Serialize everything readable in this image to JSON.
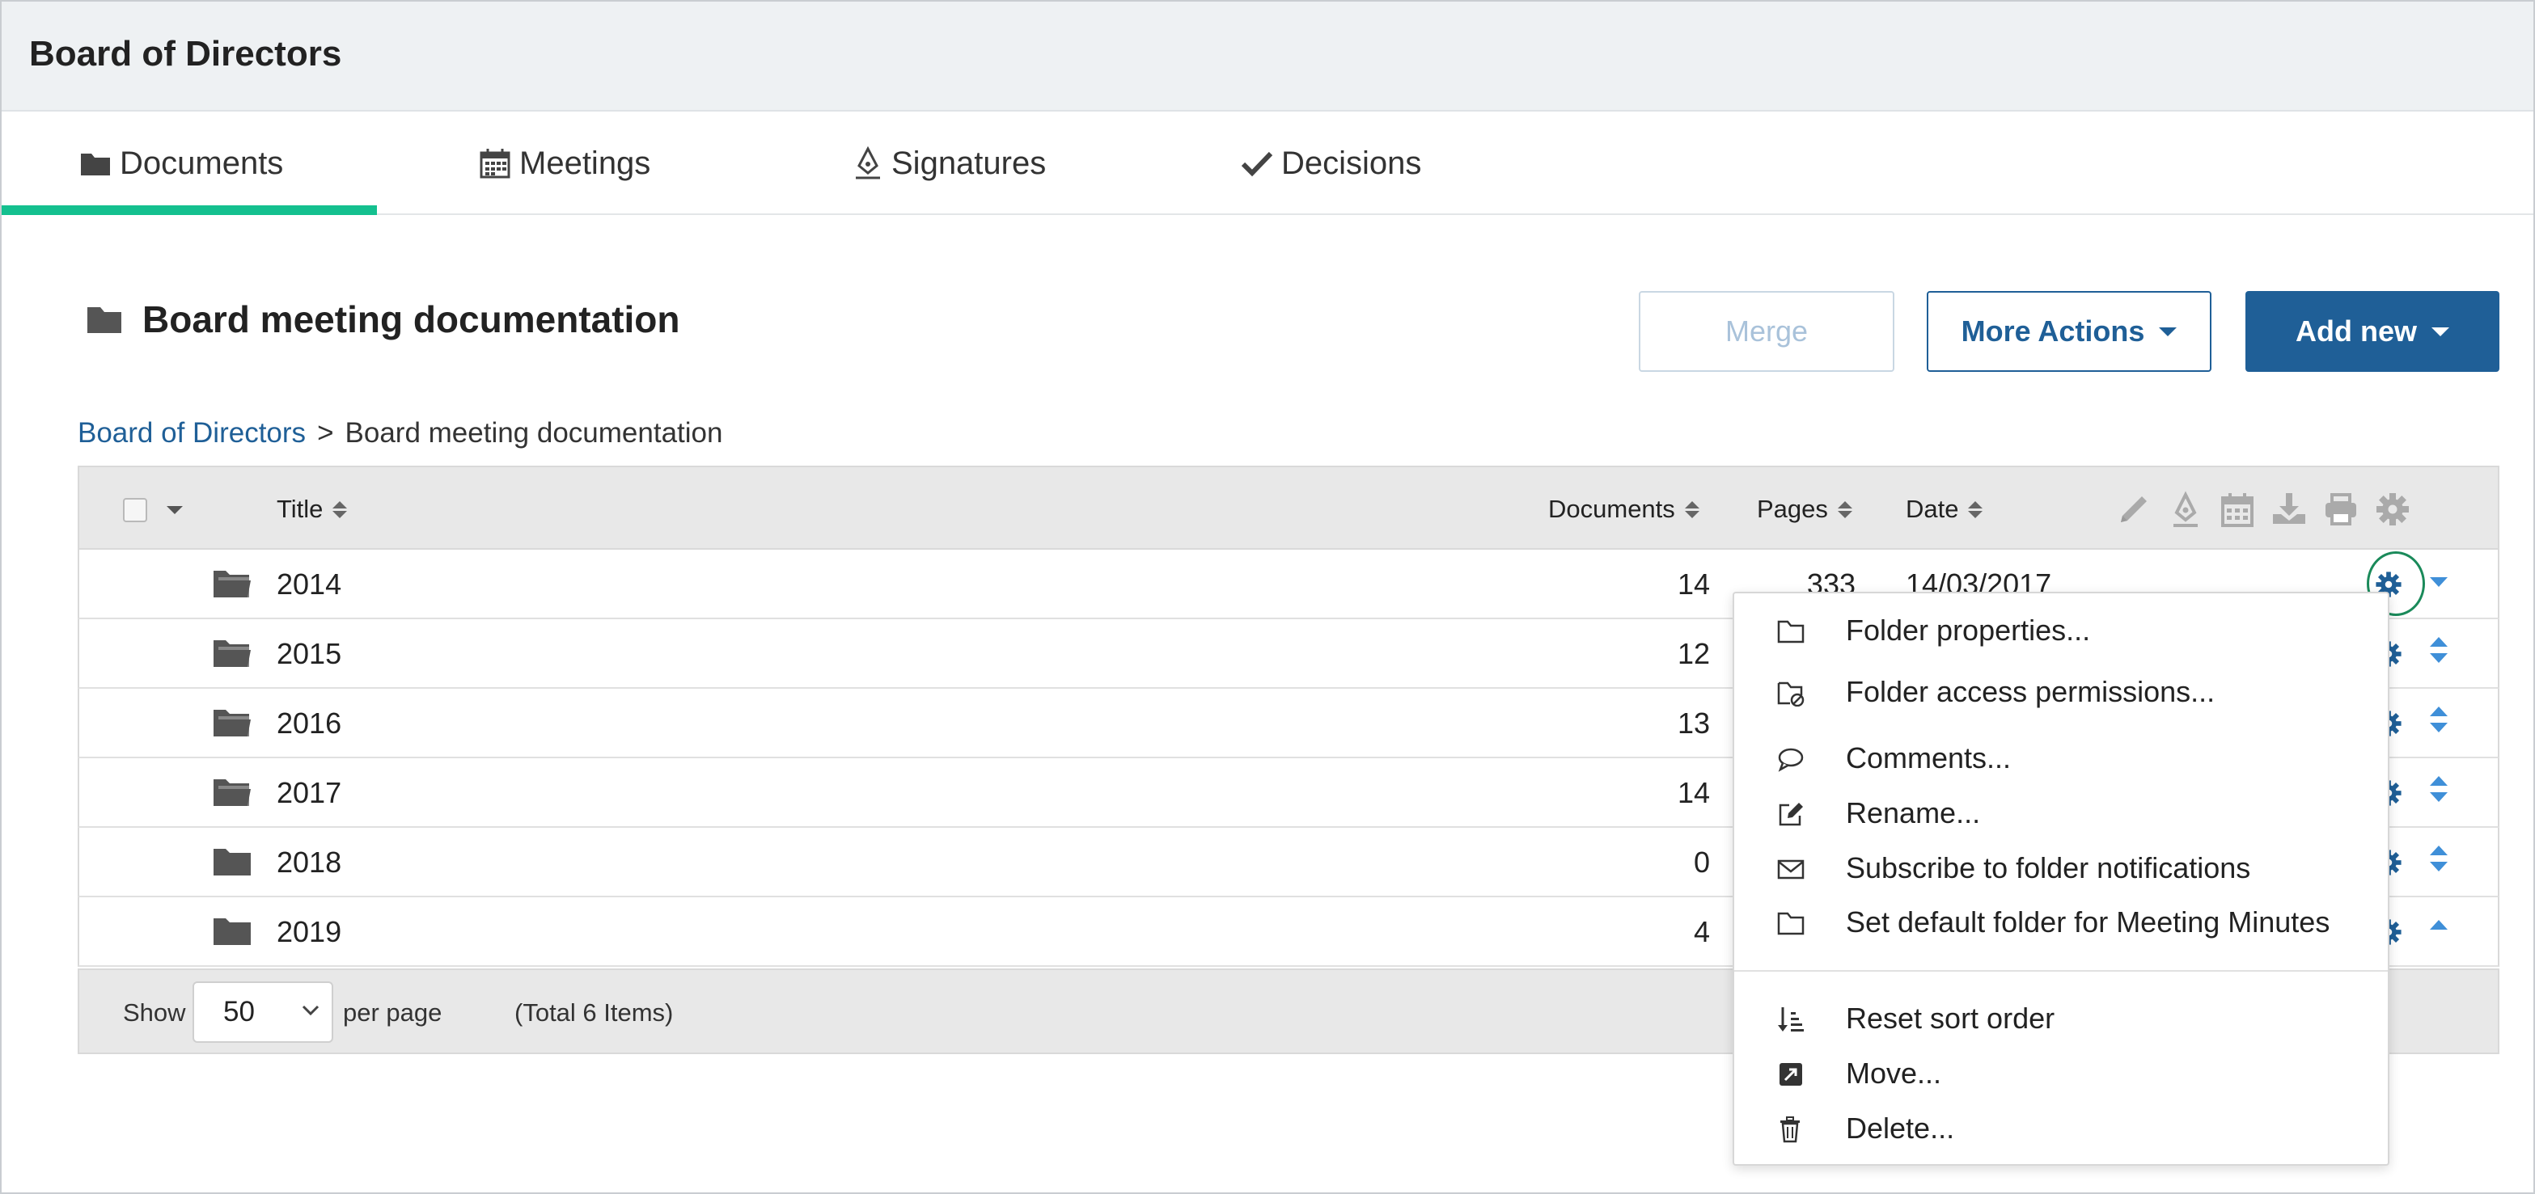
{
  "app": {
    "title": "Board of Directors"
  },
  "tabs": [
    {
      "label": "Documents",
      "icon": "folder-icon",
      "active": true
    },
    {
      "label": "Meetings",
      "icon": "calendar-icon",
      "active": false
    },
    {
      "label": "Signatures",
      "icon": "pen-nib-icon",
      "active": false
    },
    {
      "label": "Decisions",
      "icon": "check-icon",
      "active": false
    }
  ],
  "folder": {
    "title": "Board meeting documentation"
  },
  "toolbar": {
    "merge_label": "Merge",
    "more_actions_label": "More Actions",
    "add_new_label": "Add new"
  },
  "breadcrumb": {
    "root": "Board of Directors",
    "separator": ">",
    "current": "Board meeting documentation"
  },
  "table": {
    "columns": {
      "title": "Title",
      "documents": "Documents",
      "pages": "Pages",
      "date": "Date"
    },
    "header_icons": [
      "pencil-icon",
      "pen-nib-icon",
      "calendar-icon",
      "download-icon",
      "print-icon",
      "gear-icon"
    ],
    "rows": [
      {
        "title": "2014",
        "documents": "14",
        "pages": "333",
        "date": "14/03/2017",
        "icon": "folder-open-icon"
      },
      {
        "title": "2015",
        "documents": "12",
        "pages": "",
        "date": "",
        "icon": "folder-open-icon"
      },
      {
        "title": "2016",
        "documents": "13",
        "pages": "",
        "date": "",
        "icon": "folder-open-icon"
      },
      {
        "title": "2017",
        "documents": "14",
        "pages": "",
        "date": "",
        "icon": "folder-open-icon"
      },
      {
        "title": "2018",
        "documents": "0",
        "pages": "",
        "date": "",
        "icon": "folder-icon"
      },
      {
        "title": "2019",
        "documents": "4",
        "pages": "",
        "date": "",
        "icon": "folder-icon"
      }
    ]
  },
  "pagination": {
    "show_label": "Show",
    "page_size": "50",
    "per_page_label": "per page",
    "total_label": "(Total 6 Items)"
  },
  "context_menu": {
    "items": [
      {
        "label": "Folder properties...",
        "icon": "folder-outline-icon"
      },
      {
        "label": "Folder access permissions...",
        "icon": "folder-lock-icon"
      },
      {
        "label": "Comments...",
        "icon": "comment-icon"
      },
      {
        "label": "Rename...",
        "icon": "edit-icon"
      },
      {
        "label": "Subscribe to folder notifications",
        "icon": "envelope-icon"
      },
      {
        "label": "Set default folder for Meeting Minutes",
        "icon": "folder-outline-icon"
      },
      {
        "label": "Reset sort order",
        "icon": "sort-icon"
      },
      {
        "label": "Move...",
        "icon": "move-icon"
      },
      {
        "label": "Delete...",
        "icon": "trash-icon"
      }
    ]
  },
  "colors": {
    "accent": "#14c08f",
    "primary": "#1f5f97",
    "link": "#1f5f97",
    "gear_blue": "#1f5f97",
    "sort_arrow": "#3f8fd8",
    "highlight_ring": "#1a8a5a"
  }
}
